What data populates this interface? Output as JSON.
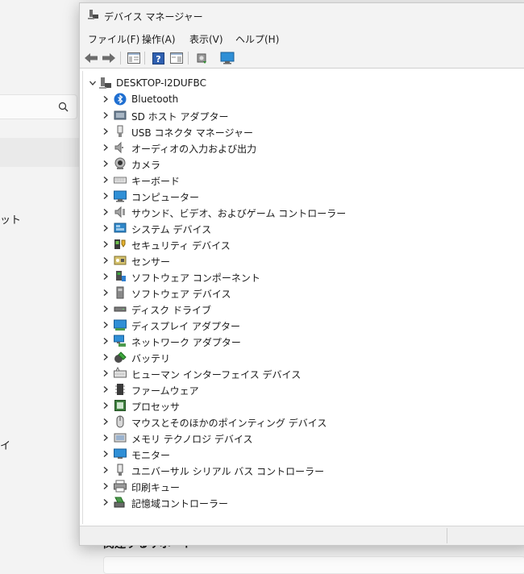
{
  "window": {
    "title": "デバイス マネージャー"
  },
  "menu": [
    "ファイル(F)",
    "操作(A)",
    "表示(V)",
    "ヘルプ(H)"
  ],
  "tree": {
    "root": "DESKTOP-I2DUFBC",
    "items": [
      {
        "label": "Bluetooth",
        "icon": "bluetooth-icon"
      },
      {
        "label": "SD ホスト アダプター",
        "icon": "sd-host-adapter-icon"
      },
      {
        "label": "USB コネクタ マネージャー",
        "icon": "usb-connector-icon"
      },
      {
        "label": "オーディオの入力および出力",
        "icon": "speaker-icon"
      },
      {
        "label": "カメラ",
        "icon": "camera-icon"
      },
      {
        "label": "キーボード",
        "icon": "keyboard-icon"
      },
      {
        "label": "コンピューター",
        "icon": "computer-icon"
      },
      {
        "label": "サウンド、ビデオ、およびゲーム コントローラー",
        "icon": "sound-icon"
      },
      {
        "label": "システム デバイス",
        "icon": "system-device-icon"
      },
      {
        "label": "セキュリティ デバイス",
        "icon": "security-device-icon"
      },
      {
        "label": "センサー",
        "icon": "sensor-icon"
      },
      {
        "label": "ソフトウェア コンポーネント",
        "icon": "software-component-icon"
      },
      {
        "label": "ソフトウェア デバイス",
        "icon": "software-device-icon"
      },
      {
        "label": "ディスク ドライブ",
        "icon": "disk-drive-icon"
      },
      {
        "label": "ディスプレイ アダプター",
        "icon": "display-adapter-icon"
      },
      {
        "label": "ネットワーク アダプター",
        "icon": "network-adapter-icon"
      },
      {
        "label": "バッテリ",
        "icon": "battery-icon"
      },
      {
        "label": "ヒューマン インターフェイス デバイス",
        "icon": "hid-icon"
      },
      {
        "label": "ファームウェア",
        "icon": "firmware-icon"
      },
      {
        "label": "プロセッサ",
        "icon": "processor-icon"
      },
      {
        "label": "マウスとそのほかのポインティング デバイス",
        "icon": "mouse-icon"
      },
      {
        "label": "メモリ テクノロジ デバイス",
        "icon": "memory-device-icon"
      },
      {
        "label": "モニター",
        "icon": "monitor-icon"
      },
      {
        "label": "ユニバーサル シリアル バス コントローラー",
        "icon": "usb-controller-icon"
      },
      {
        "label": "印刷キュー",
        "icon": "printer-icon"
      },
      {
        "label": "記憶域コントローラー",
        "icon": "storage-controller-icon"
      }
    ]
  },
  "background": {
    "fragment_1": "ット",
    "fragment_2": "イ",
    "related": "関連するサポート"
  }
}
